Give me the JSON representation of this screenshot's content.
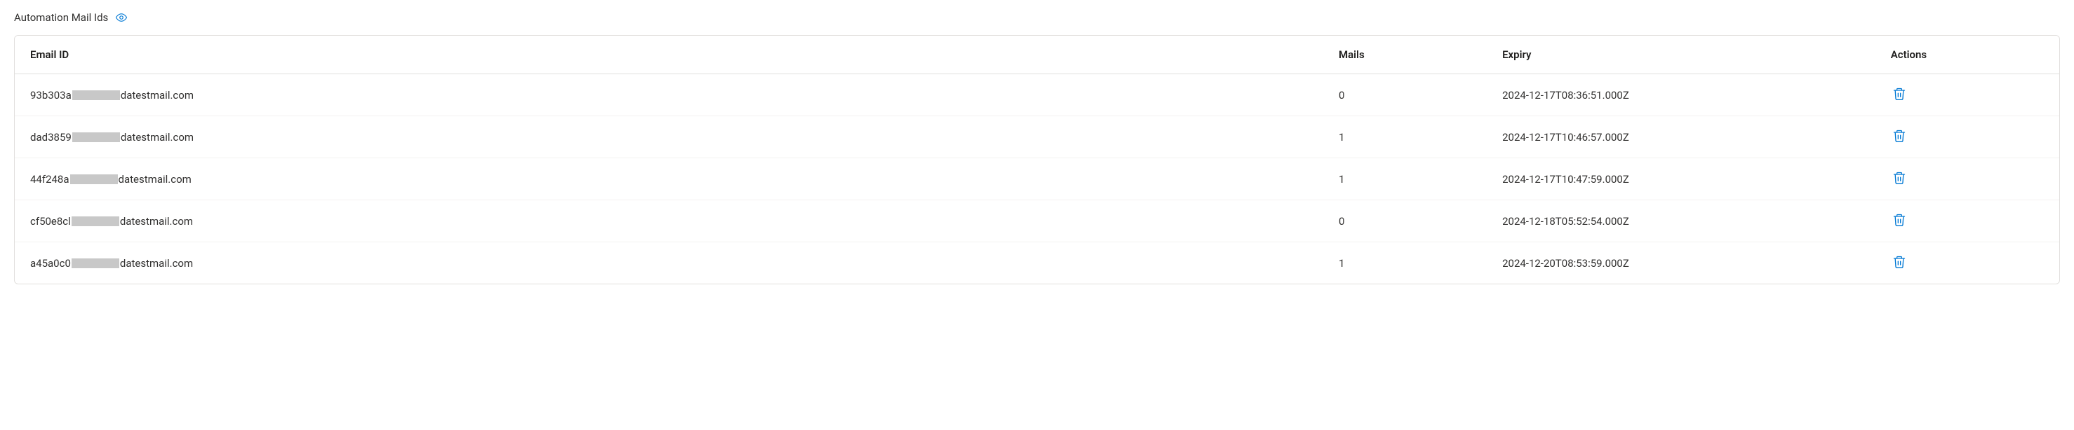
{
  "section": {
    "title": "Automation Mail Ids"
  },
  "table": {
    "headers": {
      "email": "Email ID",
      "mails": "Mails",
      "expiry": "Expiry",
      "actions": "Actions"
    },
    "rows": [
      {
        "email_prefix": "93b303a",
        "email_suffix": "datestmail.com",
        "mails": "0",
        "expiry": "2024-12-17T08:36:51.000Z"
      },
      {
        "email_prefix": "dad3859",
        "email_suffix": "datestmail.com",
        "mails": "1",
        "expiry": "2024-12-17T10:46:57.000Z"
      },
      {
        "email_prefix": "44f248a",
        "email_suffix": "datestmail.com",
        "mails": "1",
        "expiry": "2024-12-17T10:47:59.000Z"
      },
      {
        "email_prefix": "cf50e8cl",
        "email_suffix": "datestmail.com",
        "mails": "0",
        "expiry": "2024-12-18T05:52:54.000Z"
      },
      {
        "email_prefix": "a45a0c0",
        "email_suffix": "datestmail.com",
        "mails": "1",
        "expiry": "2024-12-20T08:53:59.000Z"
      }
    ]
  }
}
